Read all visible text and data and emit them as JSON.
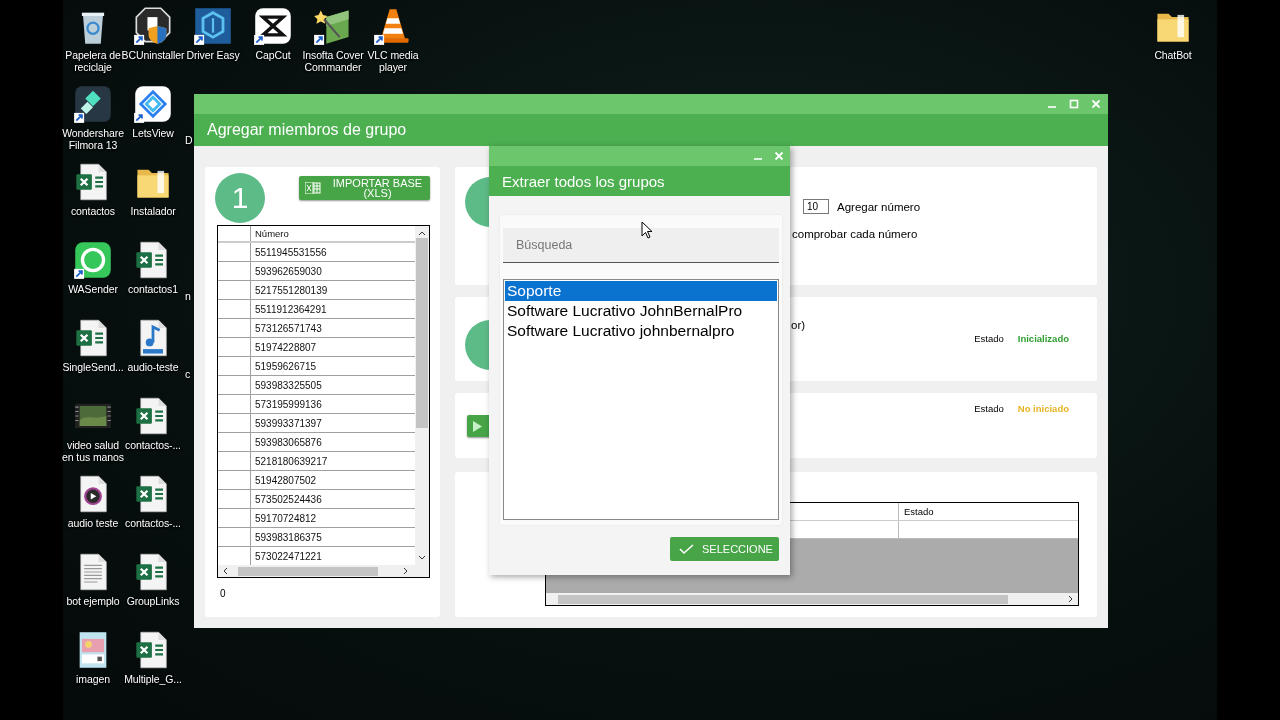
{
  "desktop": {
    "rows": [
      [
        {
          "label": "Papelera de reciclaje",
          "kind": "recycle",
          "shortcut": false
        },
        {
          "label": "BCUninstaller",
          "kind": "uninstaller",
          "shortcut": true
        },
        {
          "label": "Driver Easy",
          "kind": "driver",
          "shortcut": true
        },
        {
          "label": "CapCut",
          "kind": "capcut",
          "shortcut": true
        },
        {
          "label": "Insofta Cover Commander",
          "kind": "wand",
          "shortcut": true
        },
        {
          "label": "VLC media player",
          "kind": "cone",
          "shortcut": true
        }
      ],
      [
        {
          "label": "Wondershare Filmora 13",
          "kind": "filmora",
          "shortcut": true
        },
        {
          "label": "LetsView",
          "kind": "letsview",
          "shortcut": true
        },
        {
          "label": "D",
          "kind": "covered"
        }
      ],
      [
        {
          "label": "contactos",
          "kind": "excel",
          "shortcut": false
        },
        {
          "label": "Instalador",
          "kind": "folder",
          "shortcut": false
        }
      ],
      [
        {
          "label": "WASender",
          "kind": "wasender",
          "shortcut": true
        },
        {
          "label": "contactos1",
          "kind": "excel",
          "shortcut": false
        },
        {
          "label": "n",
          "kind": "covered"
        }
      ],
      [
        {
          "label": "SingleSend...",
          "kind": "excel",
          "shortcut": false
        },
        {
          "label": "audio-teste",
          "kind": "mp3",
          "shortcut": false
        },
        {
          "label": "c",
          "kind": "covered"
        }
      ],
      [
        {
          "label": "video salud en tus manos",
          "kind": "video",
          "shortcut": false
        },
        {
          "label": "contactos-...",
          "kind": "excel",
          "shortcut": false
        }
      ],
      [
        {
          "label": "audio teste",
          "kind": "audio",
          "shortcut": false
        },
        {
          "label": "contactos-...",
          "kind": "excel",
          "shortcut": false
        }
      ],
      [
        {
          "label": "bot ejemplo",
          "kind": "text",
          "shortcut": false
        },
        {
          "label": "GroupLinks",
          "kind": "excel",
          "shortcut": false
        }
      ],
      [
        {
          "label": "imagen",
          "kind": "image",
          "shortcut": false
        },
        {
          "label": "Multiple_G...",
          "kind": "excel",
          "shortcut": false
        }
      ]
    ],
    "right_icons": [
      {
        "label": "ChatBot",
        "kind": "folder",
        "shortcut": false
      }
    ]
  },
  "window": {
    "title": "Agregar miembros de grupo",
    "step_number": "1",
    "import_button": "IMPORTAR BASE (XLS)",
    "numbers_table": {
      "columns": [
        "Número"
      ],
      "rows": [
        "5511945531556",
        "593962659030",
        "5217551280139",
        "5511912364291",
        "573126571743",
        "51974228807",
        "51959626715",
        "593983325505",
        "573195999136",
        "593993371397",
        "593983065876",
        "5218180639217",
        "51942807502",
        "573502524436",
        "59170724812",
        "593983186375",
        "573022471221"
      ]
    },
    "row_count": "0",
    "quantity": "10",
    "add_label": "Agregar número",
    "check_label": "comprobar cada número",
    "fragment": "or)",
    "statuses": [
      {
        "label": "Estado",
        "value": "Inicializado",
        "color": "#2f9e2f"
      },
      {
        "label": "Estado",
        "value": "No iniciado",
        "color": "#e6b422"
      }
    ],
    "results_table": {
      "columns": [
        "Estado"
      ]
    }
  },
  "dialog": {
    "title": "Extraer todos los grupos",
    "search_placeholder": "Búsqueda",
    "groups": [
      {
        "label": "Soporte",
        "selected": true
      },
      {
        "label": "Software Lucrativo JohnBernalPro",
        "selected": false
      },
      {
        "label": "Software Lucrativo johnbernalpro",
        "selected": false
      }
    ],
    "button": "SELECCIONE"
  }
}
